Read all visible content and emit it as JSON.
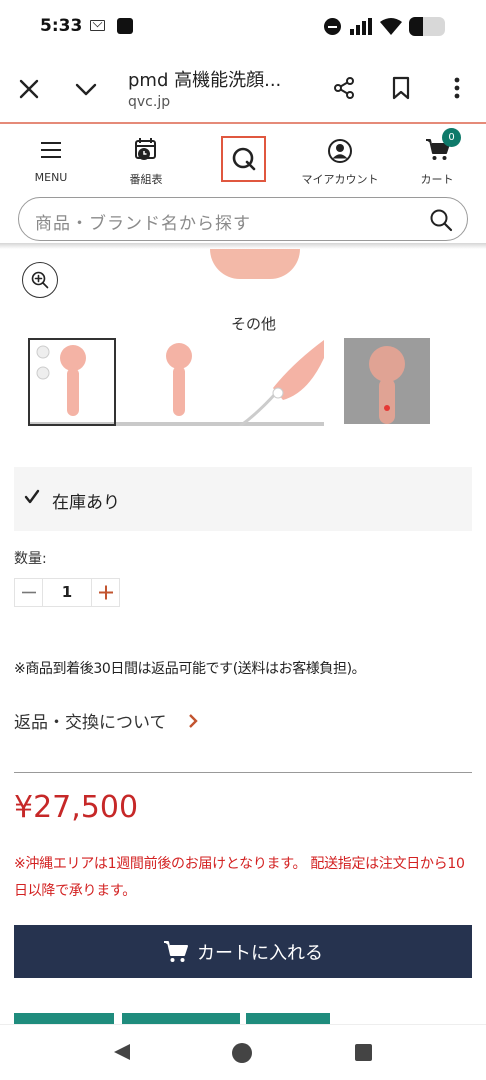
{
  "status_bar": {
    "time": "5:33",
    "battery_level": 0.4
  },
  "browser": {
    "title": "pmd 高機能洗顔...",
    "url": "qvc.jp"
  },
  "site_nav": {
    "items": [
      {
        "label": "MENU",
        "icon": "hamburger-menu-icon"
      },
      {
        "label": "番組表",
        "icon": "calendar-clock-icon"
      },
      {
        "label": "",
        "icon": "qvc-logo-icon"
      },
      {
        "label": "マイアカウント",
        "icon": "account-icon"
      },
      {
        "label": "カート",
        "icon": "cart-icon"
      }
    ],
    "cart_count": "0"
  },
  "search": {
    "placeholder": "商品・ブランド名から探す"
  },
  "gallery": {
    "label": "その他",
    "thumbnail_count": 4,
    "selected_index": 0
  },
  "stock": {
    "status": "在庫あり"
  },
  "quantity": {
    "label": "数量:",
    "value": "1",
    "minus": "−",
    "plus": "+"
  },
  "returns": {
    "note": "※商品到着後30日間は返品可能です(送料はお客様負担)。",
    "link_label": "返品・交換について"
  },
  "price": "¥27,500",
  "delivery_note": "※沖縄エリアは1週間前後のお届けとなります。 配送指定は注文日から10日以降で承ります。",
  "cart_button": {
    "label": "カートに入れる"
  },
  "colors": {
    "accent": "#e0573f",
    "price": "#c62828",
    "button": "#26334f",
    "badge": "#0e7a6a"
  }
}
